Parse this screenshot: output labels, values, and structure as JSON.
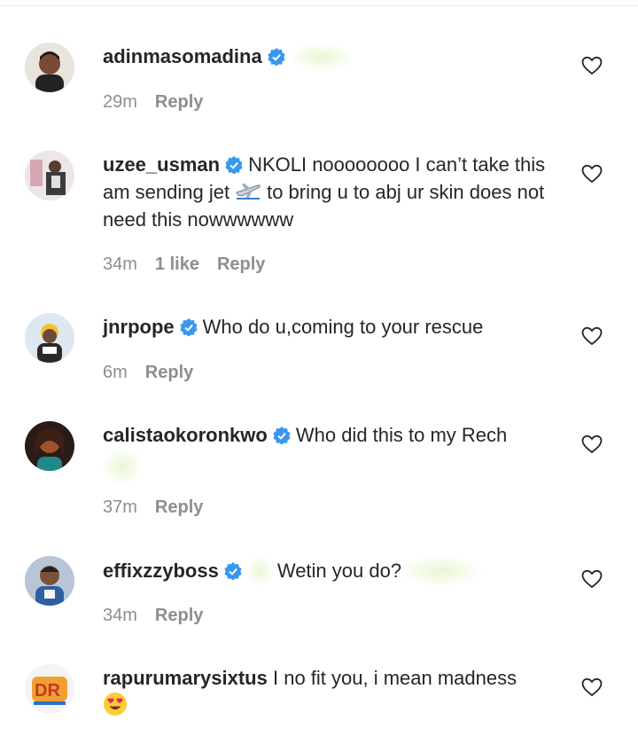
{
  "comments": [
    {
      "username": "adinmasomadina",
      "verified": true,
      "text": "",
      "time": "29m",
      "likes": "",
      "reply_label": "Reply",
      "avatar_color": "#3a2a20"
    },
    {
      "username": "uzee_usman",
      "verified": true,
      "text_part1": "NKOLI noooooooo I can’t take this am sending jet",
      "text_part2": "to bring u to abj ur skin does not need this nowwwwww",
      "time": "34m",
      "likes": "1 like",
      "reply_label": "Reply",
      "avatar_color": "#b8a99a"
    },
    {
      "username": "jnrpope",
      "verified": true,
      "text": "Who do u,coming to your rescue",
      "time": "6m",
      "likes": "",
      "reply_label": "Reply",
      "avatar_color": "#c9d6e3"
    },
    {
      "username": "calistaokoronkwo",
      "verified": true,
      "text": "Who did this to my Rech",
      "time": "37m",
      "likes": "",
      "reply_label": "Reply",
      "avatar_color": "#4a2a22"
    },
    {
      "username": "effixzzyboss",
      "verified": true,
      "text": "Wetin you do?",
      "time": "34m",
      "likes": "",
      "reply_label": "Reply",
      "avatar_color": "#8aa0b8"
    },
    {
      "username": "rapurumarysixtus",
      "verified": false,
      "text": "I no fit you, i mean madness",
      "time": "",
      "likes": "",
      "reply_label": "",
      "avatar_color": "#ffffff"
    }
  ],
  "colors": {
    "text": "#262626",
    "meta": "#8e8e8e",
    "verified": "#3897f0",
    "background": "#ffffff"
  },
  "icons": [
    "verified-badge-icon",
    "heart-icon",
    "airplane-emoji-icon",
    "heart-eyes-emoji-icon"
  ]
}
